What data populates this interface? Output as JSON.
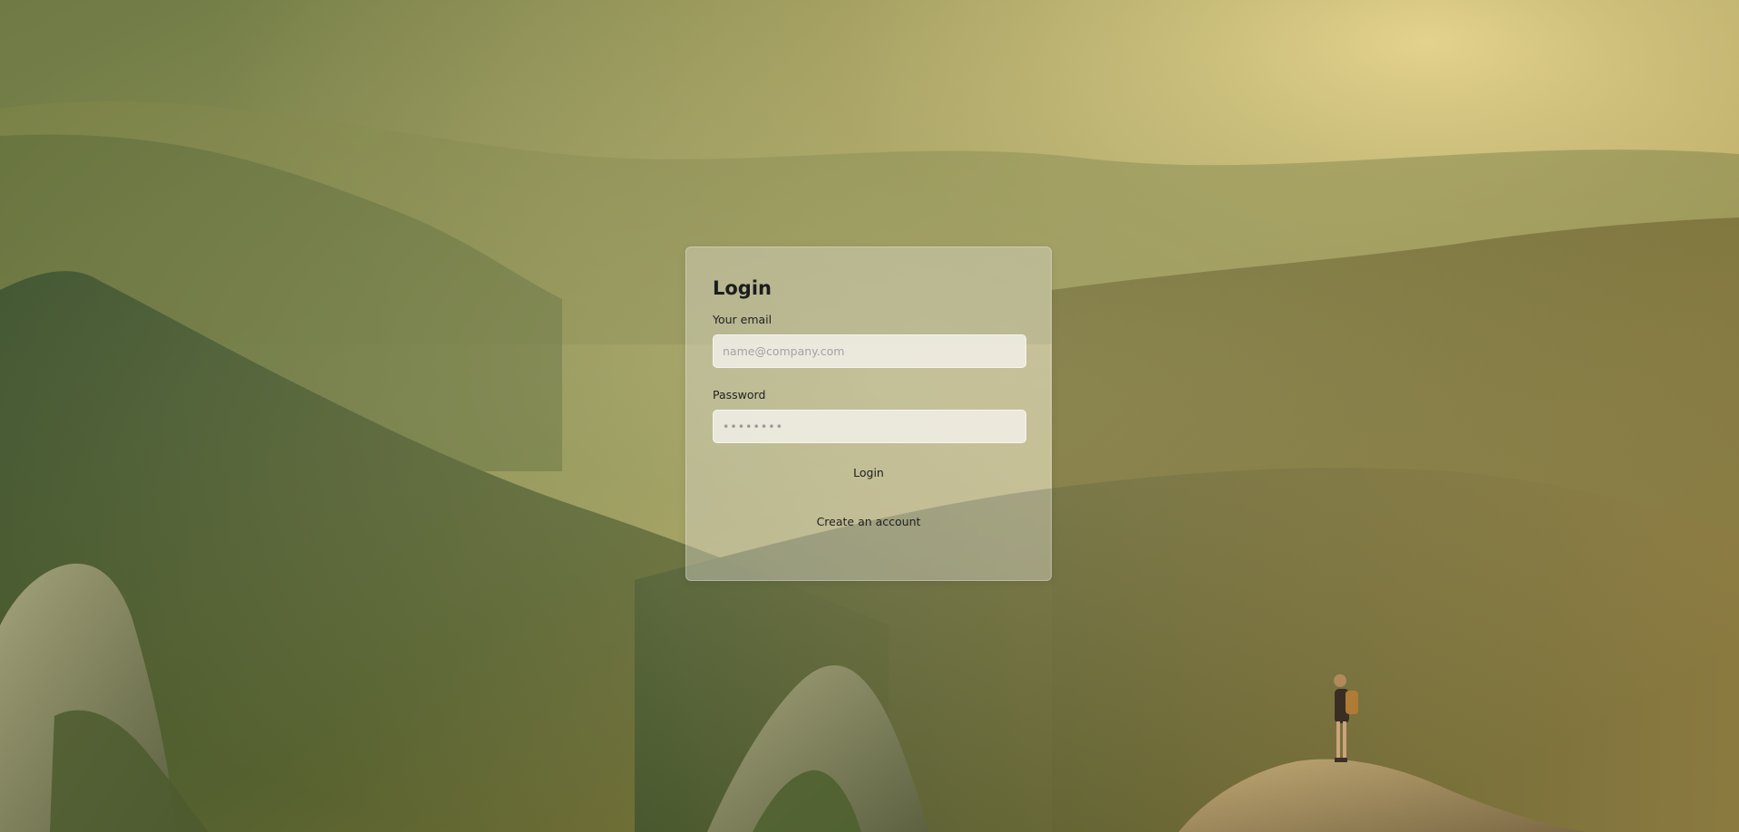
{
  "login": {
    "title": "Login",
    "email_label": "Your email",
    "email_placeholder": "name@company.com",
    "email_value": "",
    "password_label": "Password",
    "password_placeholder": "••••••••",
    "password_value": "",
    "login_button": "Login",
    "create_account_link": "Create an account"
  },
  "colors": {
    "card_background": "#dedcd0",
    "text": "#1d1d1d",
    "input_background": "#f4f2ec",
    "placeholder": "#a3a3a3"
  }
}
